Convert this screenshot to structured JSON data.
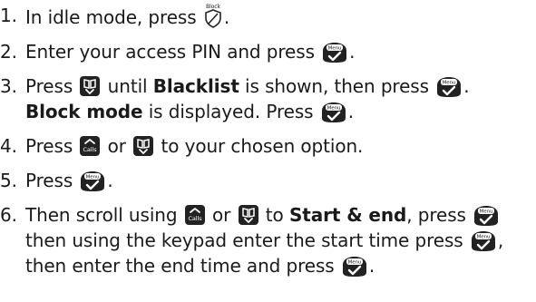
{
  "icons": {
    "menu": {
      "label": "Menu",
      "name": "menu-ok-icon"
    },
    "block": {
      "label": "Block",
      "name": "block-shield-icon"
    },
    "calls": {
      "label": "Calls",
      "name": "calls-up-icon"
    },
    "book": {
      "name": "phonebook-down-icon"
    }
  },
  "steps": [
    {
      "num": "1.",
      "t1": "In idle mode, press",
      "t2": "."
    },
    {
      "num": "2.",
      "t1": "Enter your access PIN and press",
      "t2": "."
    },
    {
      "num": "3.",
      "t1": "Press",
      "t2": "until",
      "bold1": "Blacklist",
      "t3": "is shown, then press",
      "t4": ".",
      "bold2": "Block mode",
      "t5": "is displayed. Press",
      "t6": "."
    },
    {
      "num": "4.",
      "t1": "Press",
      "t2": "or",
      "t3": "to your chosen option."
    },
    {
      "num": "5.",
      "t1": "Press",
      "t2": "."
    },
    {
      "num": "6.",
      "t1": "Then scroll using",
      "t2": "or",
      "t3": "to",
      "bold1": "Start & end",
      "t4": ", press",
      "t5": "then using the keypad enter the start time press",
      "t6": ",",
      "t7": "then enter the end time and press",
      "t8": "."
    }
  ],
  "colors": {
    "text": "#1a1a1a",
    "key": "#222222"
  }
}
